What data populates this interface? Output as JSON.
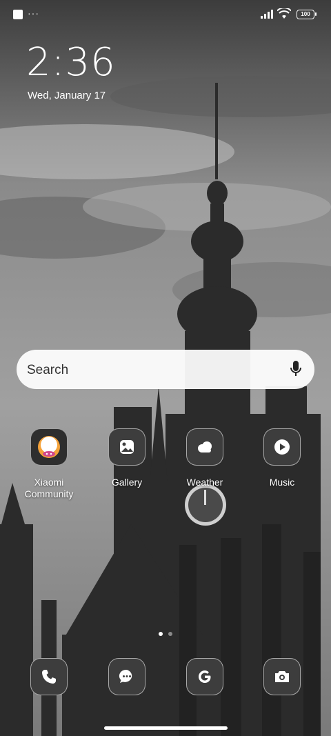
{
  "status_bar": {
    "time_hidden": "",
    "more": "···",
    "battery": "100"
  },
  "clock": {
    "time": "2:36",
    "date": "Wed, January 17"
  },
  "search": {
    "placeholder": "Search",
    "icon": "mic-icon"
  },
  "apps": [
    {
      "label": "Xiaomi\nCommunity",
      "icon": "xiaomi-community-icon"
    },
    {
      "label": "Gallery",
      "icon": "gallery-icon"
    },
    {
      "label": "Weather",
      "icon": "weather-icon"
    },
    {
      "label": "Music",
      "icon": "music-icon"
    }
  ],
  "dock": [
    {
      "icon": "phone-icon"
    },
    {
      "icon": "messages-icon"
    },
    {
      "icon": "google-icon"
    },
    {
      "icon": "camera-icon"
    }
  ],
  "page_indicator": {
    "current": 1,
    "total": 2
  }
}
